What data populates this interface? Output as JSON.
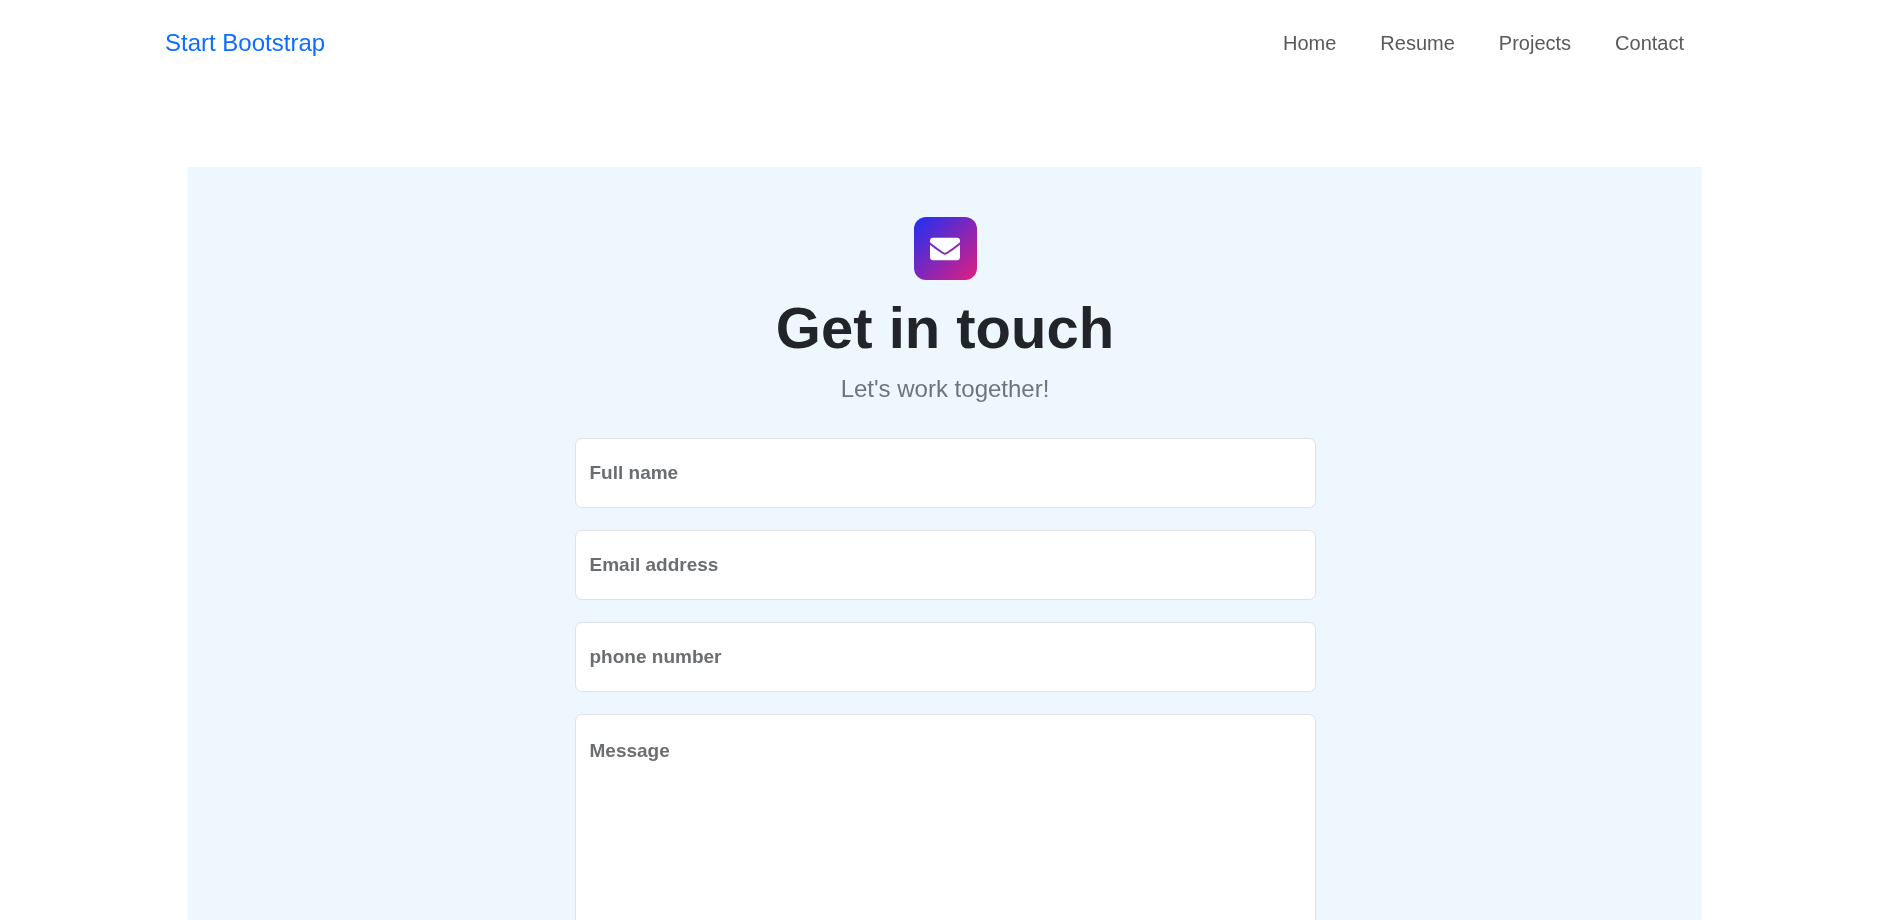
{
  "navbar": {
    "brand": "Start Bootstrap",
    "links": [
      "Home",
      "Resume",
      "Projects",
      "Contact"
    ]
  },
  "contact": {
    "title": "Get in touch",
    "subtitle": "Let's work together!",
    "fields": [
      {
        "kind": "input",
        "placeholder": "Full name"
      },
      {
        "kind": "input",
        "placeholder": "Email address"
      },
      {
        "kind": "input",
        "placeholder": "phone number"
      },
      {
        "kind": "textarea",
        "placeholder": "Message"
      }
    ]
  }
}
